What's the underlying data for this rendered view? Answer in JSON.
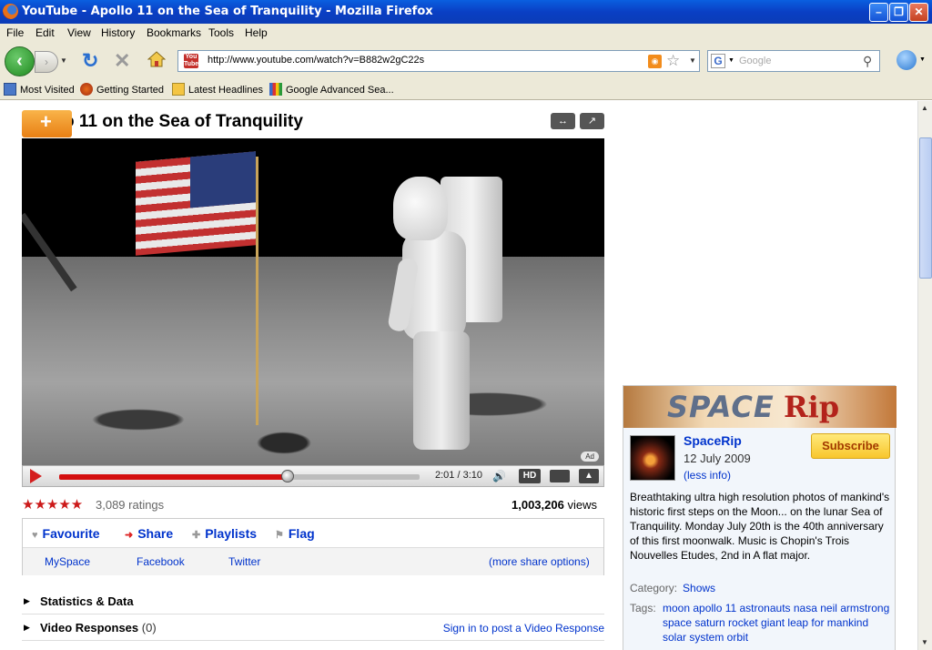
{
  "window": {
    "title": "YouTube - Apollo 11 on the Sea of Tranquility - Mozilla Firefox"
  },
  "menu": [
    "File",
    "Edit",
    "View",
    "History",
    "Bookmarks",
    "Tools",
    "Help"
  ],
  "nav": {
    "url": "http://www.youtube.com/watch?v=B882w2gC22s",
    "search_placeholder": "Google",
    "search_engine_icon": "G"
  },
  "bookmarks": [
    "Most Visited",
    "Getting Started",
    "Latest Headlines",
    "Google Advanced Sea..."
  ],
  "video": {
    "title": "o 11 on the Sea of Tranquility",
    "add_label": "+",
    "ad_label": "Ad",
    "time": "2:01 / 3:10",
    "progress": 0.635,
    "hd_label": "HD",
    "ratings_count": "3,089 ratings",
    "views_count": "1,003,206",
    "views_suffix": " views",
    "stars": "★★★★★"
  },
  "actions": {
    "favourite": "Favourite",
    "share": "Share",
    "playlists": "Playlists",
    "flag": "Flag"
  },
  "share": {
    "myspace": "MySpace",
    "facebook": "Facebook",
    "twitter": "Twitter",
    "more": "(more share options)"
  },
  "sections": {
    "stats": "Statistics & Data",
    "responses": "Video Responses",
    "responses_count": "(0)",
    "responses_link": "Sign in to post a Video Response"
  },
  "channel": {
    "banner_part1": "SPACE",
    "banner_part2": "Rip",
    "name": "SpaceRip",
    "date": "12 July 2009",
    "less_info": "(less info)",
    "subscribe": "Subscribe",
    "description": "Breathtaking ultra high resolution photos of mankind's historic first steps on the Moon... on the lunar Sea of Tranquility. Monday July 20th is the 40th anniversary of this first moonwalk. Music is Chopin's Trois Nouvelles Etudes, 2nd in A flat major.",
    "category_label": "Category:",
    "category_value": "Shows",
    "tags_label": "Tags:",
    "tags": "moon apollo 11 astronauts nasa neil armstrong space saturn rocket giant leap for mankind solar system orbit"
  },
  "colors": {
    "accent": "#0033cc",
    "youtube_red": "#d40f0f",
    "subscribe": "#f8c62c"
  }
}
